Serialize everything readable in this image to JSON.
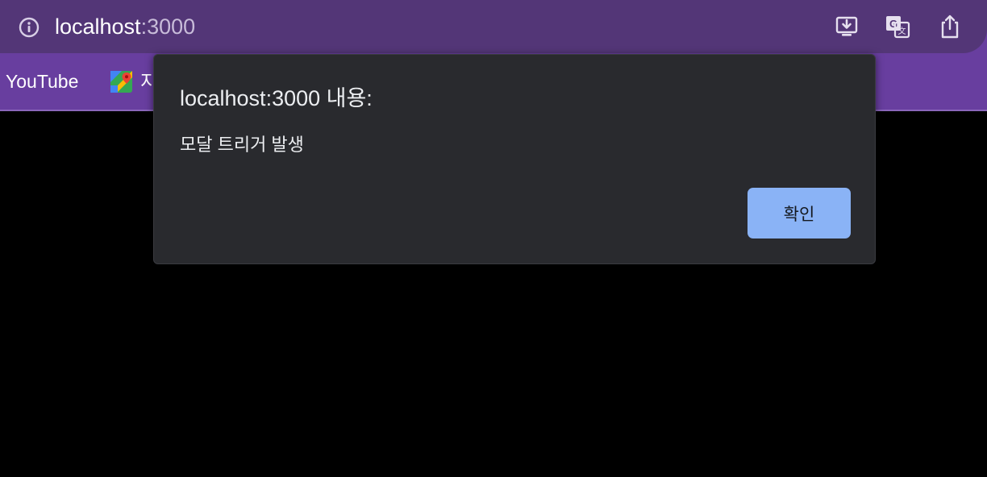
{
  "omnibox": {
    "host": "localhost",
    "port": ":3000"
  },
  "bookmarks": {
    "items": [
      {
        "label": "YouTube",
        "icon": "youtube"
      },
      {
        "label": "지",
        "icon": "google-maps-icon"
      }
    ]
  },
  "dialog": {
    "title": "localhost:3000 내용:",
    "message": "모달 트리거 발생",
    "ok_label": "확인"
  },
  "colors": {
    "accent": "#8ab3f6",
    "toolbar": "#533677",
    "bookmarks_bar": "#683e9f",
    "dialog_bg": "#292a2e"
  }
}
